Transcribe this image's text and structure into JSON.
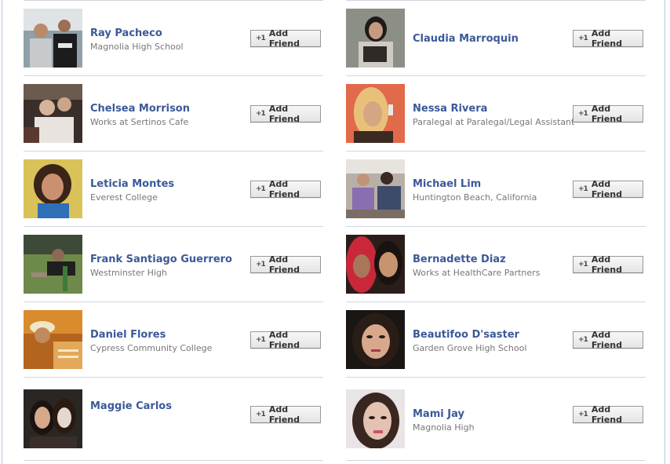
{
  "button_label": "Add Friend",
  "button_icon": "+1",
  "left_column": [
    {
      "name": "Ray Pacheco",
      "subtitle": "Magnolia High School"
    },
    {
      "name": "Chelsea Morrison",
      "subtitle": "Works at Sertinos Cafe"
    },
    {
      "name": "Leticia Montes",
      "subtitle": "Everest College"
    },
    {
      "name": "Frank Santiago Guerrero",
      "subtitle": "Westminster High"
    },
    {
      "name": "Daniel Flores",
      "subtitle": "Cypress Community College"
    },
    {
      "name": "Maggie Carlos",
      "subtitle": ""
    }
  ],
  "right_column": [
    {
      "name": "Claudia Marroquin",
      "subtitle": ""
    },
    {
      "name": "Nessa Rivera",
      "subtitle": "Paralegal at Paralegal/Legal Assistant"
    },
    {
      "name": "Michael Lim",
      "subtitle": "Huntington Beach, California"
    },
    {
      "name": "Bernadette Diaz",
      "subtitle": "Works at HealthCare Partners"
    },
    {
      "name": "Beautifoo D'saster",
      "subtitle": "Garden Grove High School"
    },
    {
      "name": "Mami Jay",
      "subtitle": "Magnolia High"
    }
  ],
  "colors": {
    "name_link": "#3b5998",
    "subtitle": "#777777",
    "separator": "#d3d6db",
    "frame": "#b9c4d8"
  }
}
